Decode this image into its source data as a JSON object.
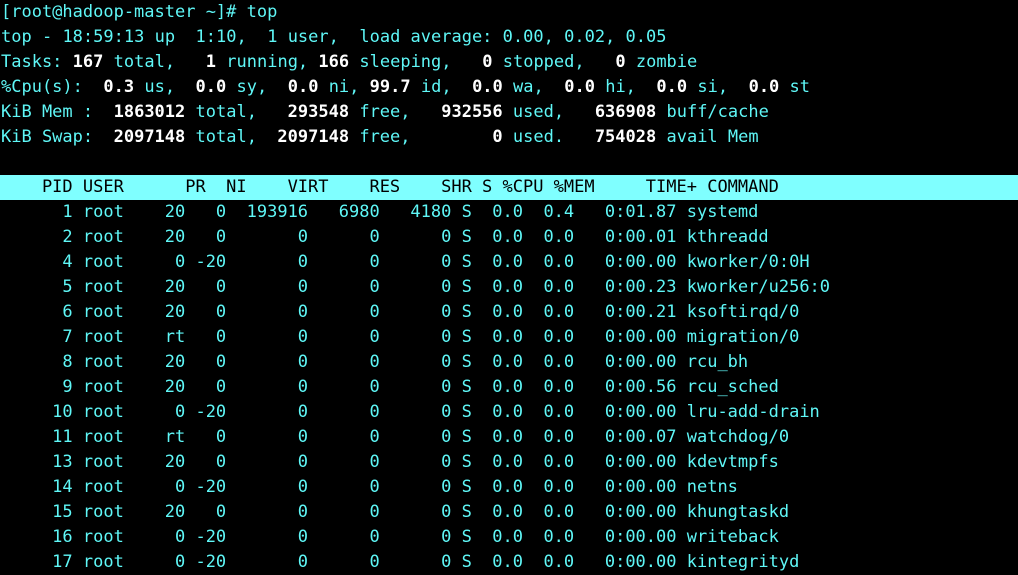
{
  "terminal": {
    "colors": {
      "background": "#000000",
      "foreground": "#5FF7F7",
      "bold_white": "#FFFFFF",
      "header_background": "#7FFFFF",
      "header_foreground": "#000000"
    },
    "prompt_line": {
      "prompt": "[root@hadoop-master ~]# ",
      "command": "top",
      "user": "root",
      "host": "hadoop-master",
      "cwd": "~"
    },
    "summary": {
      "uptime_line": {
        "program": "top",
        "time": "18:59:13",
        "up_label": "up",
        "uptime": "1:10,",
        "users": "1 user,",
        "load_label": "load average:",
        "load_1": "0.00,",
        "load_5": "0.02,",
        "load_15": "0.05"
      },
      "tasks_line": {
        "label": "Tasks:",
        "total": "167",
        "total_label": "total,",
        "running": "1",
        "running_label": "running,",
        "sleeping": "166",
        "sleeping_label": "sleeping,",
        "stopped": "0",
        "stopped_label": "stopped,",
        "zombie": "0",
        "zombie_label": "zombie"
      },
      "cpu_line": {
        "label": "%Cpu(s):",
        "us": "0.3",
        "us_label": "us,",
        "sy": "0.0",
        "sy_label": "sy,",
        "ni": "0.0",
        "ni_label": "ni,",
        "id": "99.7",
        "id_label": "id,",
        "wa": "0.0",
        "wa_label": "wa,",
        "hi": "0.0",
        "hi_label": "hi,",
        "si": "0.0",
        "si_label": "si,",
        "st": "0.0",
        "st_label": "st"
      },
      "mem_line": {
        "label": "KiB Mem :",
        "total": "1863012",
        "total_label": "total,",
        "free": "293548",
        "free_label": "free,",
        "used": "932556",
        "used_label": "used,",
        "buff_cache": "636908",
        "buff_cache_label": "buff/cache"
      },
      "swap_line": {
        "label": "KiB Swap:",
        "total": "2097148",
        "total_label": "total,",
        "free": "2097148",
        "free_label": "free,",
        "used": "0",
        "used_label": "used.",
        "avail": "754028",
        "avail_label": "avail Mem"
      }
    },
    "table": {
      "columns": [
        "PID",
        "USER",
        "PR",
        "NI",
        "VIRT",
        "RES",
        "SHR",
        "S",
        "%CPU",
        "%MEM",
        "TIME+",
        "COMMAND"
      ],
      "header_text": "    PID USER      PR  NI    VIRT    RES    SHR S %CPU %MEM     TIME+ COMMAND",
      "rows": [
        {
          "pid": "1",
          "user": "root",
          "pr": "20",
          "ni": "0",
          "virt": "193916",
          "res": "6980",
          "shr": "4180",
          "s": "S",
          "cpu": "0.0",
          "mem": "0.4",
          "time": "0:01.87",
          "command": "systemd"
        },
        {
          "pid": "2",
          "user": "root",
          "pr": "20",
          "ni": "0",
          "virt": "0",
          "res": "0",
          "shr": "0",
          "s": "S",
          "cpu": "0.0",
          "mem": "0.0",
          "time": "0:00.01",
          "command": "kthreadd"
        },
        {
          "pid": "4",
          "user": "root",
          "pr": "0",
          "ni": "-20",
          "virt": "0",
          "res": "0",
          "shr": "0",
          "s": "S",
          "cpu": "0.0",
          "mem": "0.0",
          "time": "0:00.00",
          "command": "kworker/0:0H"
        },
        {
          "pid": "5",
          "user": "root",
          "pr": "20",
          "ni": "0",
          "virt": "0",
          "res": "0",
          "shr": "0",
          "s": "S",
          "cpu": "0.0",
          "mem": "0.0",
          "time": "0:00.23",
          "command": "kworker/u256:0"
        },
        {
          "pid": "6",
          "user": "root",
          "pr": "20",
          "ni": "0",
          "virt": "0",
          "res": "0",
          "shr": "0",
          "s": "S",
          "cpu": "0.0",
          "mem": "0.0",
          "time": "0:00.21",
          "command": "ksoftirqd/0"
        },
        {
          "pid": "7",
          "user": "root",
          "pr": "rt",
          "ni": "0",
          "virt": "0",
          "res": "0",
          "shr": "0",
          "s": "S",
          "cpu": "0.0",
          "mem": "0.0",
          "time": "0:00.00",
          "command": "migration/0"
        },
        {
          "pid": "8",
          "user": "root",
          "pr": "20",
          "ni": "0",
          "virt": "0",
          "res": "0",
          "shr": "0",
          "s": "S",
          "cpu": "0.0",
          "mem": "0.0",
          "time": "0:00.00",
          "command": "rcu_bh"
        },
        {
          "pid": "9",
          "user": "root",
          "pr": "20",
          "ni": "0",
          "virt": "0",
          "res": "0",
          "shr": "0",
          "s": "S",
          "cpu": "0.0",
          "mem": "0.0",
          "time": "0:00.56",
          "command": "rcu_sched"
        },
        {
          "pid": "10",
          "user": "root",
          "pr": "0",
          "ni": "-20",
          "virt": "0",
          "res": "0",
          "shr": "0",
          "s": "S",
          "cpu": "0.0",
          "mem": "0.0",
          "time": "0:00.00",
          "command": "lru-add-drain"
        },
        {
          "pid": "11",
          "user": "root",
          "pr": "rt",
          "ni": "0",
          "virt": "0",
          "res": "0",
          "shr": "0",
          "s": "S",
          "cpu": "0.0",
          "mem": "0.0",
          "time": "0:00.07",
          "command": "watchdog/0"
        },
        {
          "pid": "13",
          "user": "root",
          "pr": "20",
          "ni": "0",
          "virt": "0",
          "res": "0",
          "shr": "0",
          "s": "S",
          "cpu": "0.0",
          "mem": "0.0",
          "time": "0:00.00",
          "command": "kdevtmpfs"
        },
        {
          "pid": "14",
          "user": "root",
          "pr": "0",
          "ni": "-20",
          "virt": "0",
          "res": "0",
          "shr": "0",
          "s": "S",
          "cpu": "0.0",
          "mem": "0.0",
          "time": "0:00.00",
          "command": "netns"
        },
        {
          "pid": "15",
          "user": "root",
          "pr": "20",
          "ni": "0",
          "virt": "0",
          "res": "0",
          "shr": "0",
          "s": "S",
          "cpu": "0.0",
          "mem": "0.0",
          "time": "0:00.00",
          "command": "khungtaskd"
        },
        {
          "pid": "16",
          "user": "root",
          "pr": "0",
          "ni": "-20",
          "virt": "0",
          "res": "0",
          "shr": "0",
          "s": "S",
          "cpu": "0.0",
          "mem": "0.0",
          "time": "0:00.00",
          "command": "writeback"
        },
        {
          "pid": "17",
          "user": "root",
          "pr": "0",
          "ni": "-20",
          "virt": "0",
          "res": "0",
          "shr": "0",
          "s": "S",
          "cpu": "0.0",
          "mem": "0.0",
          "time": "0:00.00",
          "command": "kintegrityd"
        }
      ]
    }
  }
}
